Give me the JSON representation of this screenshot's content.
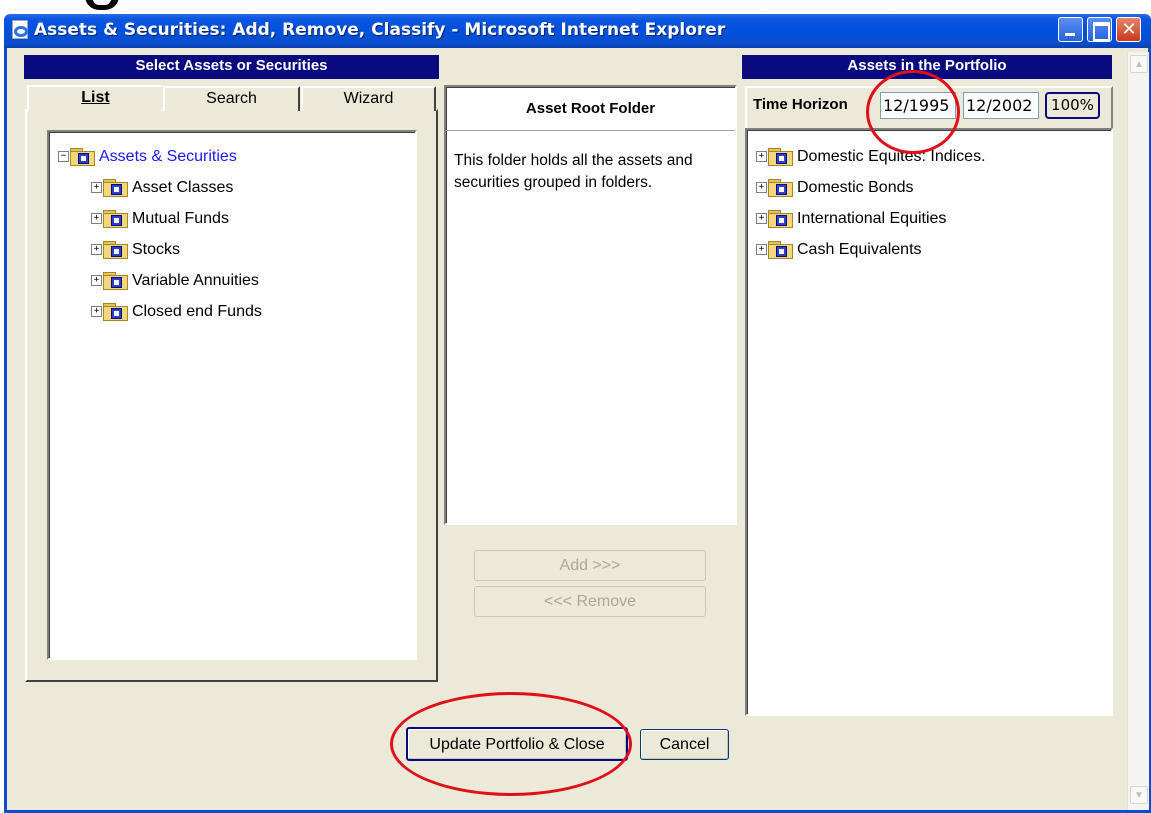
{
  "window": {
    "title": "Assets & Securities: Add, Remove, Classify - Microsoft Internet Explorer",
    "minimize": "_",
    "maximize": "□",
    "close": "✕"
  },
  "left_panel": {
    "header": "Select Assets or Securities",
    "tabs": [
      "List",
      "Search",
      "Wizard"
    ],
    "tree": {
      "root": "Assets & Securities",
      "children": [
        "Asset Classes",
        "Mutual Funds",
        "Stocks",
        "Variable Annuities",
        "Closed end Funds"
      ]
    }
  },
  "middle_panel": {
    "header": "Asset Root Folder",
    "description": "This folder holds all the assets and securities grouped in folders.",
    "add_label": "Add >>>",
    "remove_label": "<<< Remove"
  },
  "right_panel": {
    "header": "Assets in the Portfolio",
    "time_horizon_label": "Time Horizon",
    "start": "12/1995",
    "end": "12/2002",
    "percent_label": "100%",
    "tree": [
      "Domestic Equites: Indices.",
      "Domestic Bonds",
      "International Equities",
      "Cash Equivalents"
    ]
  },
  "footer": {
    "update_label": "Update Portfolio & Close",
    "cancel_label": "Cancel"
  },
  "colors": {
    "annotation": "#e0101a",
    "header_bg": "#0a0a80",
    "link": "#1a1aff"
  },
  "icons": [
    "ie-page-icon",
    "folder-icon",
    "plus-icon",
    "minus-icon",
    "scroll-up-icon",
    "scroll-down-icon"
  ]
}
